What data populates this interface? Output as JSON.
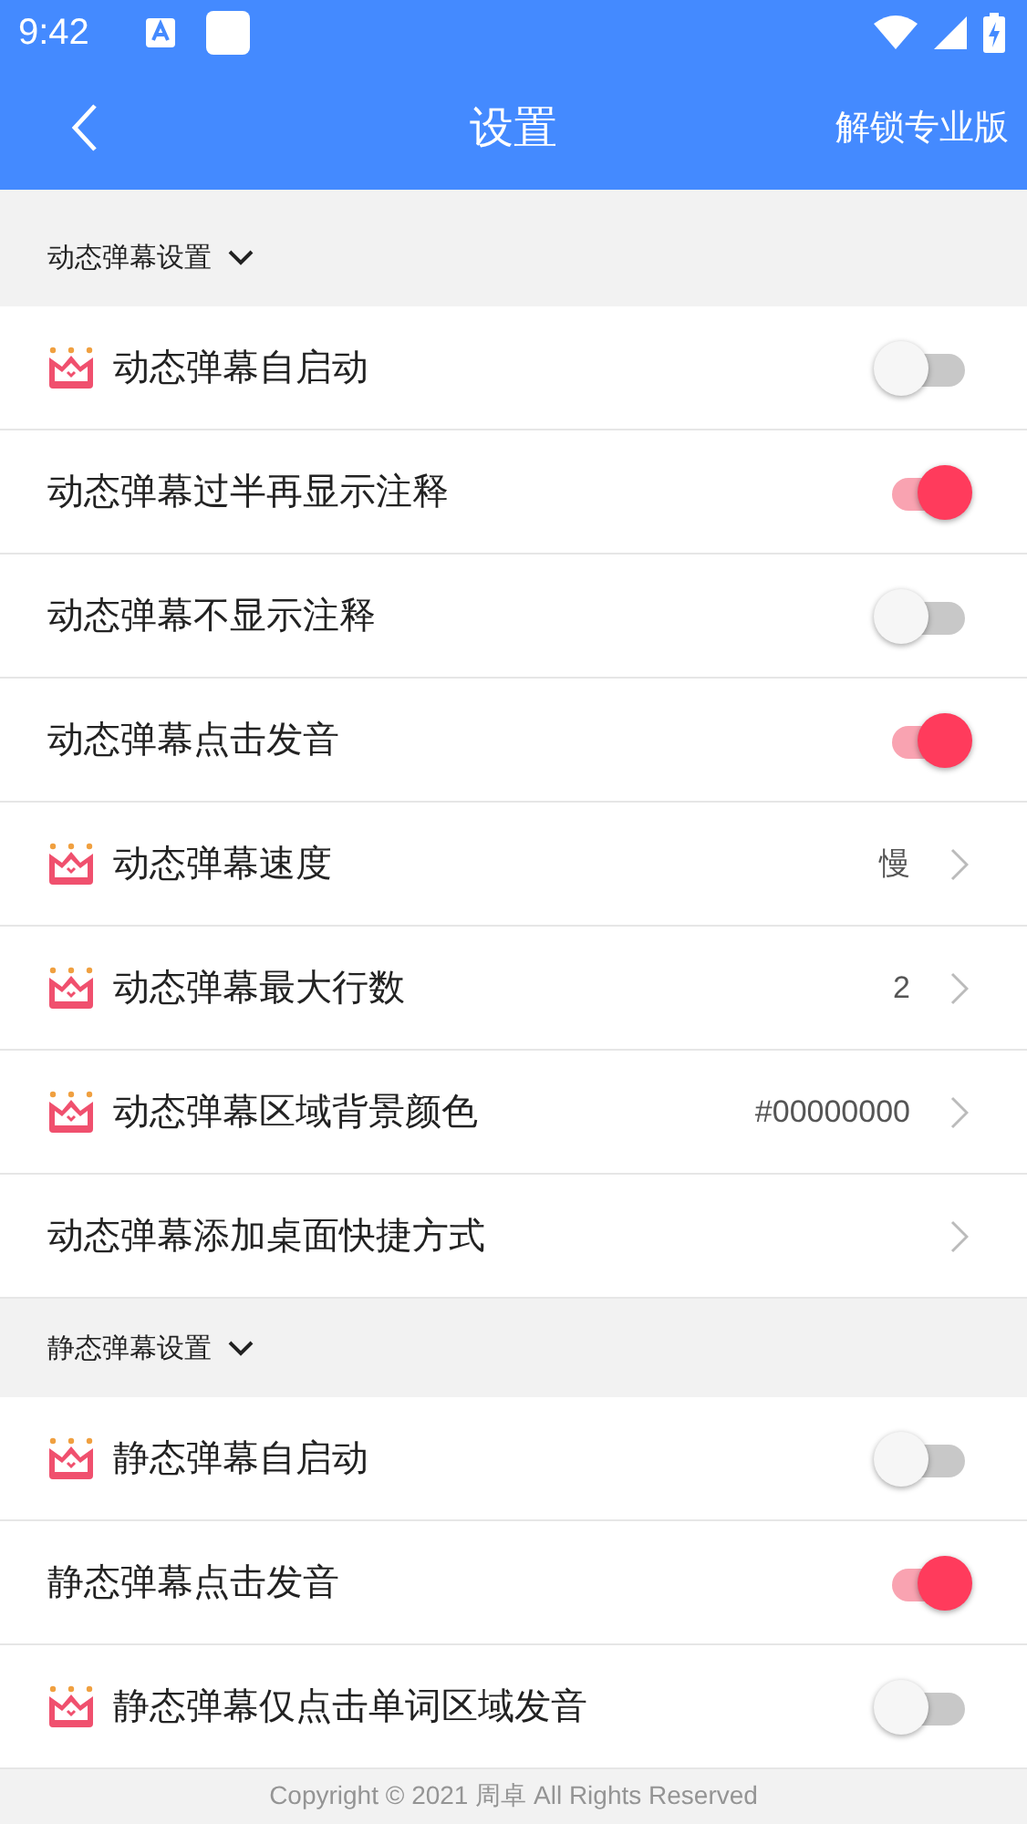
{
  "status_bar": {
    "time": "9:42"
  },
  "app_bar": {
    "title": "设置",
    "action": "解锁专业版"
  },
  "sections": [
    {
      "title": "动态弹幕设置",
      "expanded": true,
      "items": [
        {
          "kind": "toggle",
          "label": "动态弹幕自启动",
          "premium": true,
          "on": false
        },
        {
          "kind": "toggle",
          "label": "动态弹幕过半再显示注释",
          "premium": false,
          "on": true
        },
        {
          "kind": "toggle",
          "label": "动态弹幕不显示注释",
          "premium": false,
          "on": false
        },
        {
          "kind": "toggle",
          "label": "动态弹幕点击发音",
          "premium": false,
          "on": true
        },
        {
          "kind": "value",
          "label": "动态弹幕速度",
          "premium": true,
          "value": "慢"
        },
        {
          "kind": "value",
          "label": "动态弹幕最大行数",
          "premium": true,
          "value": "2"
        },
        {
          "kind": "value",
          "label": "动态弹幕区域背景颜色",
          "premium": true,
          "value": "#00000000"
        },
        {
          "kind": "value",
          "label": "动态弹幕添加桌面快捷方式",
          "premium": false
        }
      ]
    },
    {
      "title": "静态弹幕设置",
      "expanded": true,
      "items": [
        {
          "kind": "toggle",
          "label": "静态弹幕自启动",
          "premium": true,
          "on": false
        },
        {
          "kind": "toggle",
          "label": "静态弹幕点击发音",
          "premium": false,
          "on": true
        },
        {
          "kind": "toggle",
          "label": "静态弹幕仅点击单词区域发音",
          "premium": true,
          "on": false
        }
      ]
    }
  ],
  "footer": "Copyright © 2021 周卓 All Rights Reserved"
}
